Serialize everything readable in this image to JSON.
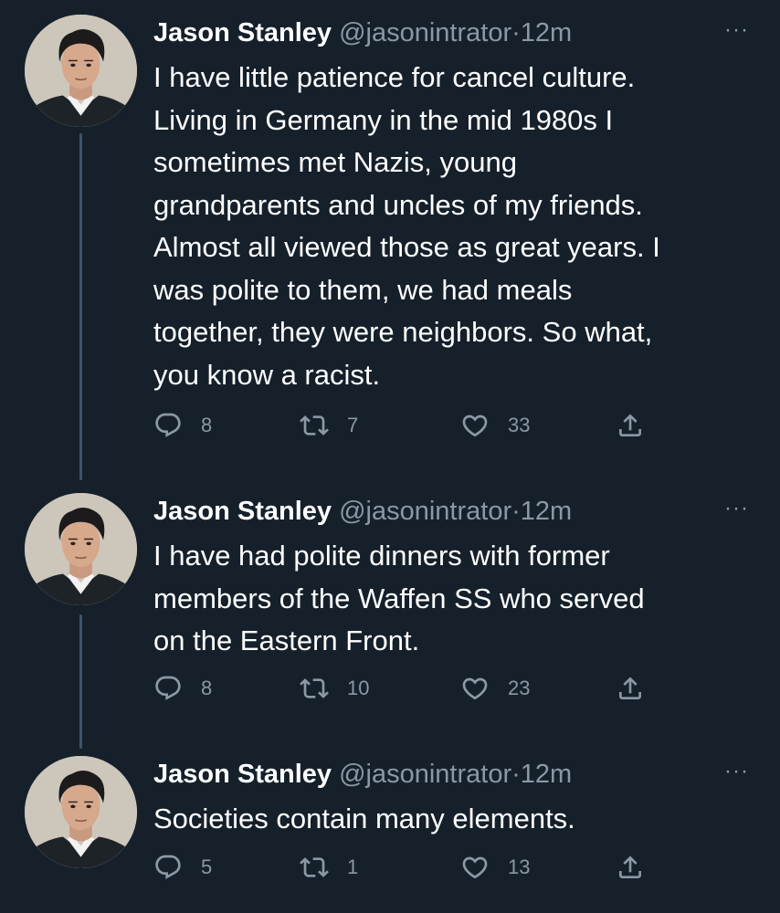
{
  "tweets": [
    {
      "name": "Jason Stanley",
      "handle": "@jasonintrator",
      "separator": "·",
      "time": "12m",
      "more": "···",
      "lines": [
        "I have little patience for cancel culture.",
        "Living in Germany in the mid 1980s I",
        "sometimes met Nazis, young",
        "grandparents and uncles of my friends.",
        "Almost all viewed those as great years. I",
        "was polite to them, we had meals",
        "together, they were neighbors. So what,",
        "you know a racist."
      ],
      "replies": "8",
      "retweets": "7",
      "likes": "33"
    },
    {
      "name": "Jason Stanley",
      "handle": "@jasonintrator",
      "separator": "·",
      "time": "12m",
      "more": "···",
      "lines": [
        "I have had polite dinners with former",
        "members of the Waffen SS who served",
        "on the Eastern Front."
      ],
      "replies": "8",
      "retweets": "10",
      "likes": "23"
    },
    {
      "name": "Jason Stanley",
      "handle": "@jasonintrator",
      "separator": "·",
      "time": "12m",
      "more": "···",
      "lines": [
        "Societies contain many elements."
      ],
      "replies": "5",
      "retweets": "1",
      "likes": "13"
    }
  ],
  "icons": {
    "reply": "reply-icon",
    "retweet": "retweet-icon",
    "like": "heart-icon",
    "share": "share-icon"
  },
  "colors": {
    "background": "#15202b",
    "text": "#ffffff",
    "secondary": "#8b98a5",
    "thread_line": "#3d5466"
  }
}
